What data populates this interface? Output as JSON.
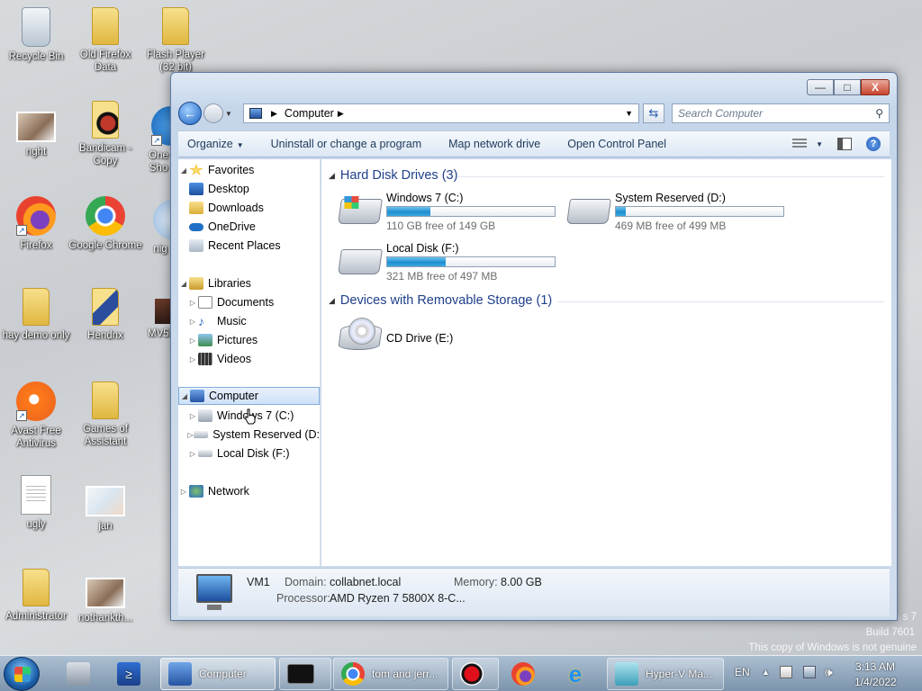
{
  "desktop": {
    "icons": [
      {
        "label": "Recycle Bin"
      },
      {
        "label": "Old Firefox Data"
      },
      {
        "label": "Flash Player (32 bit)"
      },
      {
        "label": "nght"
      },
      {
        "label": "Bandicam - Copy"
      },
      {
        "label": "One Sho"
      },
      {
        "label": "Firefox"
      },
      {
        "label": "Google Chrome"
      },
      {
        "label": "nig"
      },
      {
        "label": "hay demo only"
      },
      {
        "label": "Hendnx"
      },
      {
        "label": "MV5B"
      },
      {
        "label": "Avast Free Antivirus"
      },
      {
        "label": "Games of Assistant"
      },
      {
        "label": "ugly"
      },
      {
        "label": "jan"
      },
      {
        "label": "Administrator"
      },
      {
        "label": "nothankth..."
      }
    ],
    "watermark": {
      "line1": "s 7",
      "line2": "Build 7601",
      "line3": "This copy of Windows is not genuine"
    }
  },
  "window": {
    "buttons": {
      "minimize": "—",
      "maximize": "□",
      "close": "X"
    },
    "address": {
      "location": "Computer"
    },
    "search": {
      "placeholder": "Search Computer"
    },
    "toolbar": {
      "organize": "Organize",
      "uninstall": "Uninstall or change a program",
      "map_drive": "Map network drive",
      "control_panel": "Open Control Panel",
      "help": "?"
    },
    "nav": {
      "favorites": "Favorites",
      "desktop": "Desktop",
      "downloads": "Downloads",
      "onedrive": "OneDrive",
      "recent": "Recent Places",
      "libraries": "Libraries",
      "documents": "Documents",
      "music": "Music",
      "pictures": "Pictures",
      "videos": "Videos",
      "computer": "Computer",
      "drive_c": "Windows 7 (C:)",
      "drive_d": "System Reserved (D:",
      "drive_f": "Local Disk (F:)",
      "network": "Network"
    },
    "content": {
      "hdd_header": "Hard Disk Drives (3)",
      "removable_header": "Devices with Removable Storage (1)",
      "drives": [
        {
          "name": "Windows 7 (C:)",
          "free": "110 GB free of 149 GB",
          "used_fraction": 0.26
        },
        {
          "name": "System Reserved (D:)",
          "free": "469 MB free of 499 MB",
          "used_fraction": 0.06
        },
        {
          "name": "Local Disk (F:)",
          "free": "321 MB free of 497 MB",
          "used_fraction": 0.35
        }
      ],
      "cd": {
        "name": "CD Drive (E:)"
      }
    },
    "details": {
      "name": "VM1",
      "domain_label": "Domain:",
      "domain": "collabnet.local",
      "memory_label": "Memory:",
      "memory": "8.00 GB",
      "processor_label": "Processor:",
      "processor": "AMD Ryzen 7 5800X 8-C..."
    }
  },
  "taskbar": {
    "explorer": "Computer",
    "chrome": "tom and jerr...",
    "hyperv": "Hyper-V Ma...",
    "lang": "EN",
    "time": "3:13 AM",
    "date": "1/4/2022"
  },
  "colors": {
    "accent": "#1e3f8a",
    "drive_bar": "#1f8fd1",
    "window_frame": "#c5d6ea"
  }
}
